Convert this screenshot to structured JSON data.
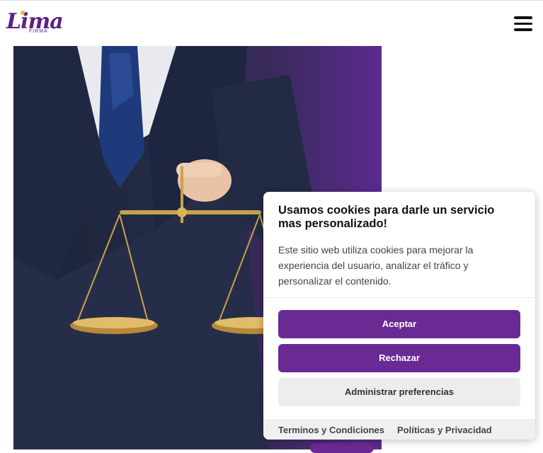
{
  "header": {
    "logo_text": "Lima",
    "logo_subtext": "FIRMA",
    "menu_icon": "hamburger-icon"
  },
  "hero": {
    "image_alt": "Lawyer in suit holding golden justice scales"
  },
  "cookie_banner": {
    "title": "Usamos cookies para darle un servicio mas personalizado!",
    "text": "Este sitio web utiliza cookies para mejorar la experiencia del usuario, analizar el tráfico y personalizar el contenido.",
    "accept_label": "Aceptar",
    "reject_label": "Rechazar",
    "preferences_label": "Administrar preferencias",
    "terms_link": "Terminos y Condiciones",
    "privacy_link": "Políticas y Privacidad"
  },
  "colors": {
    "brand_purple": "#6a2a94",
    "logo_purple": "#5b2185",
    "logo_accent": "#f2b51d"
  }
}
